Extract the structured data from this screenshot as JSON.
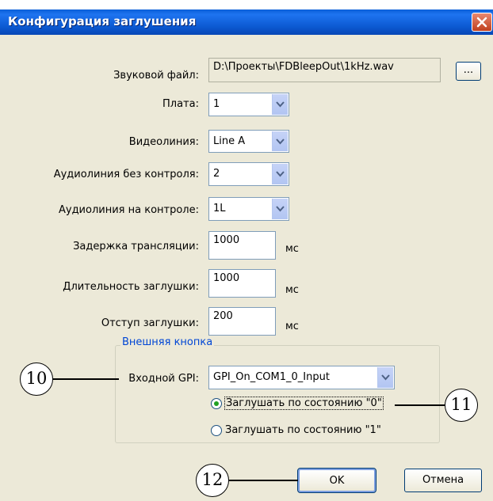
{
  "window": {
    "title": "Конфигурация заглушения"
  },
  "form": {
    "sound_file": {
      "label": "Звуковой файл:",
      "value": "D:\\Проекты\\FDBleepOut\\1kHz.wav",
      "browse_label": "..."
    },
    "board": {
      "label": "Плата:",
      "value": "1"
    },
    "video_line": {
      "label": "Видеолиния:",
      "value": "Line A"
    },
    "audio_uncontrolled": {
      "label": "Аудиолиния без контроля:",
      "value": "2"
    },
    "audio_controlled": {
      "label": "Аудиолиния на контроле:",
      "value": "1L"
    },
    "broadcast_delay": {
      "label": "Задержка трансляции:",
      "value": "1000",
      "unit": "мс"
    },
    "bleep_duration": {
      "label": "Длительность заглушки:",
      "value": "1000",
      "unit": "мс"
    },
    "bleep_offset": {
      "label": "Отступ заглушки:",
      "value": "200",
      "unit": "мс"
    }
  },
  "external_button": {
    "group_title": "Внешняя кнопка",
    "gpi_label": "Входной GPI:",
    "gpi_value": "GPI_On_COM1_0_Input",
    "radio_0": {
      "label": "Заглушать по состоянию \"0\"",
      "checked": true
    },
    "radio_1": {
      "label": "Заглушать по состоянию \"1\"",
      "checked": false
    }
  },
  "buttons": {
    "ok": "OK",
    "cancel": "Отмена"
  },
  "callouts": [
    "10",
    "11",
    "12"
  ],
  "icons": {
    "close": "close-icon",
    "dropdown": "chevron-down-icon",
    "radio_selected": "radio-selected-icon"
  },
  "colors": {
    "titlebar": "#0b58d0",
    "close_button": "#c0401e",
    "window_bg": "#ece9d8",
    "group_title": "#0046d5",
    "radio_dot": "#21a121"
  }
}
